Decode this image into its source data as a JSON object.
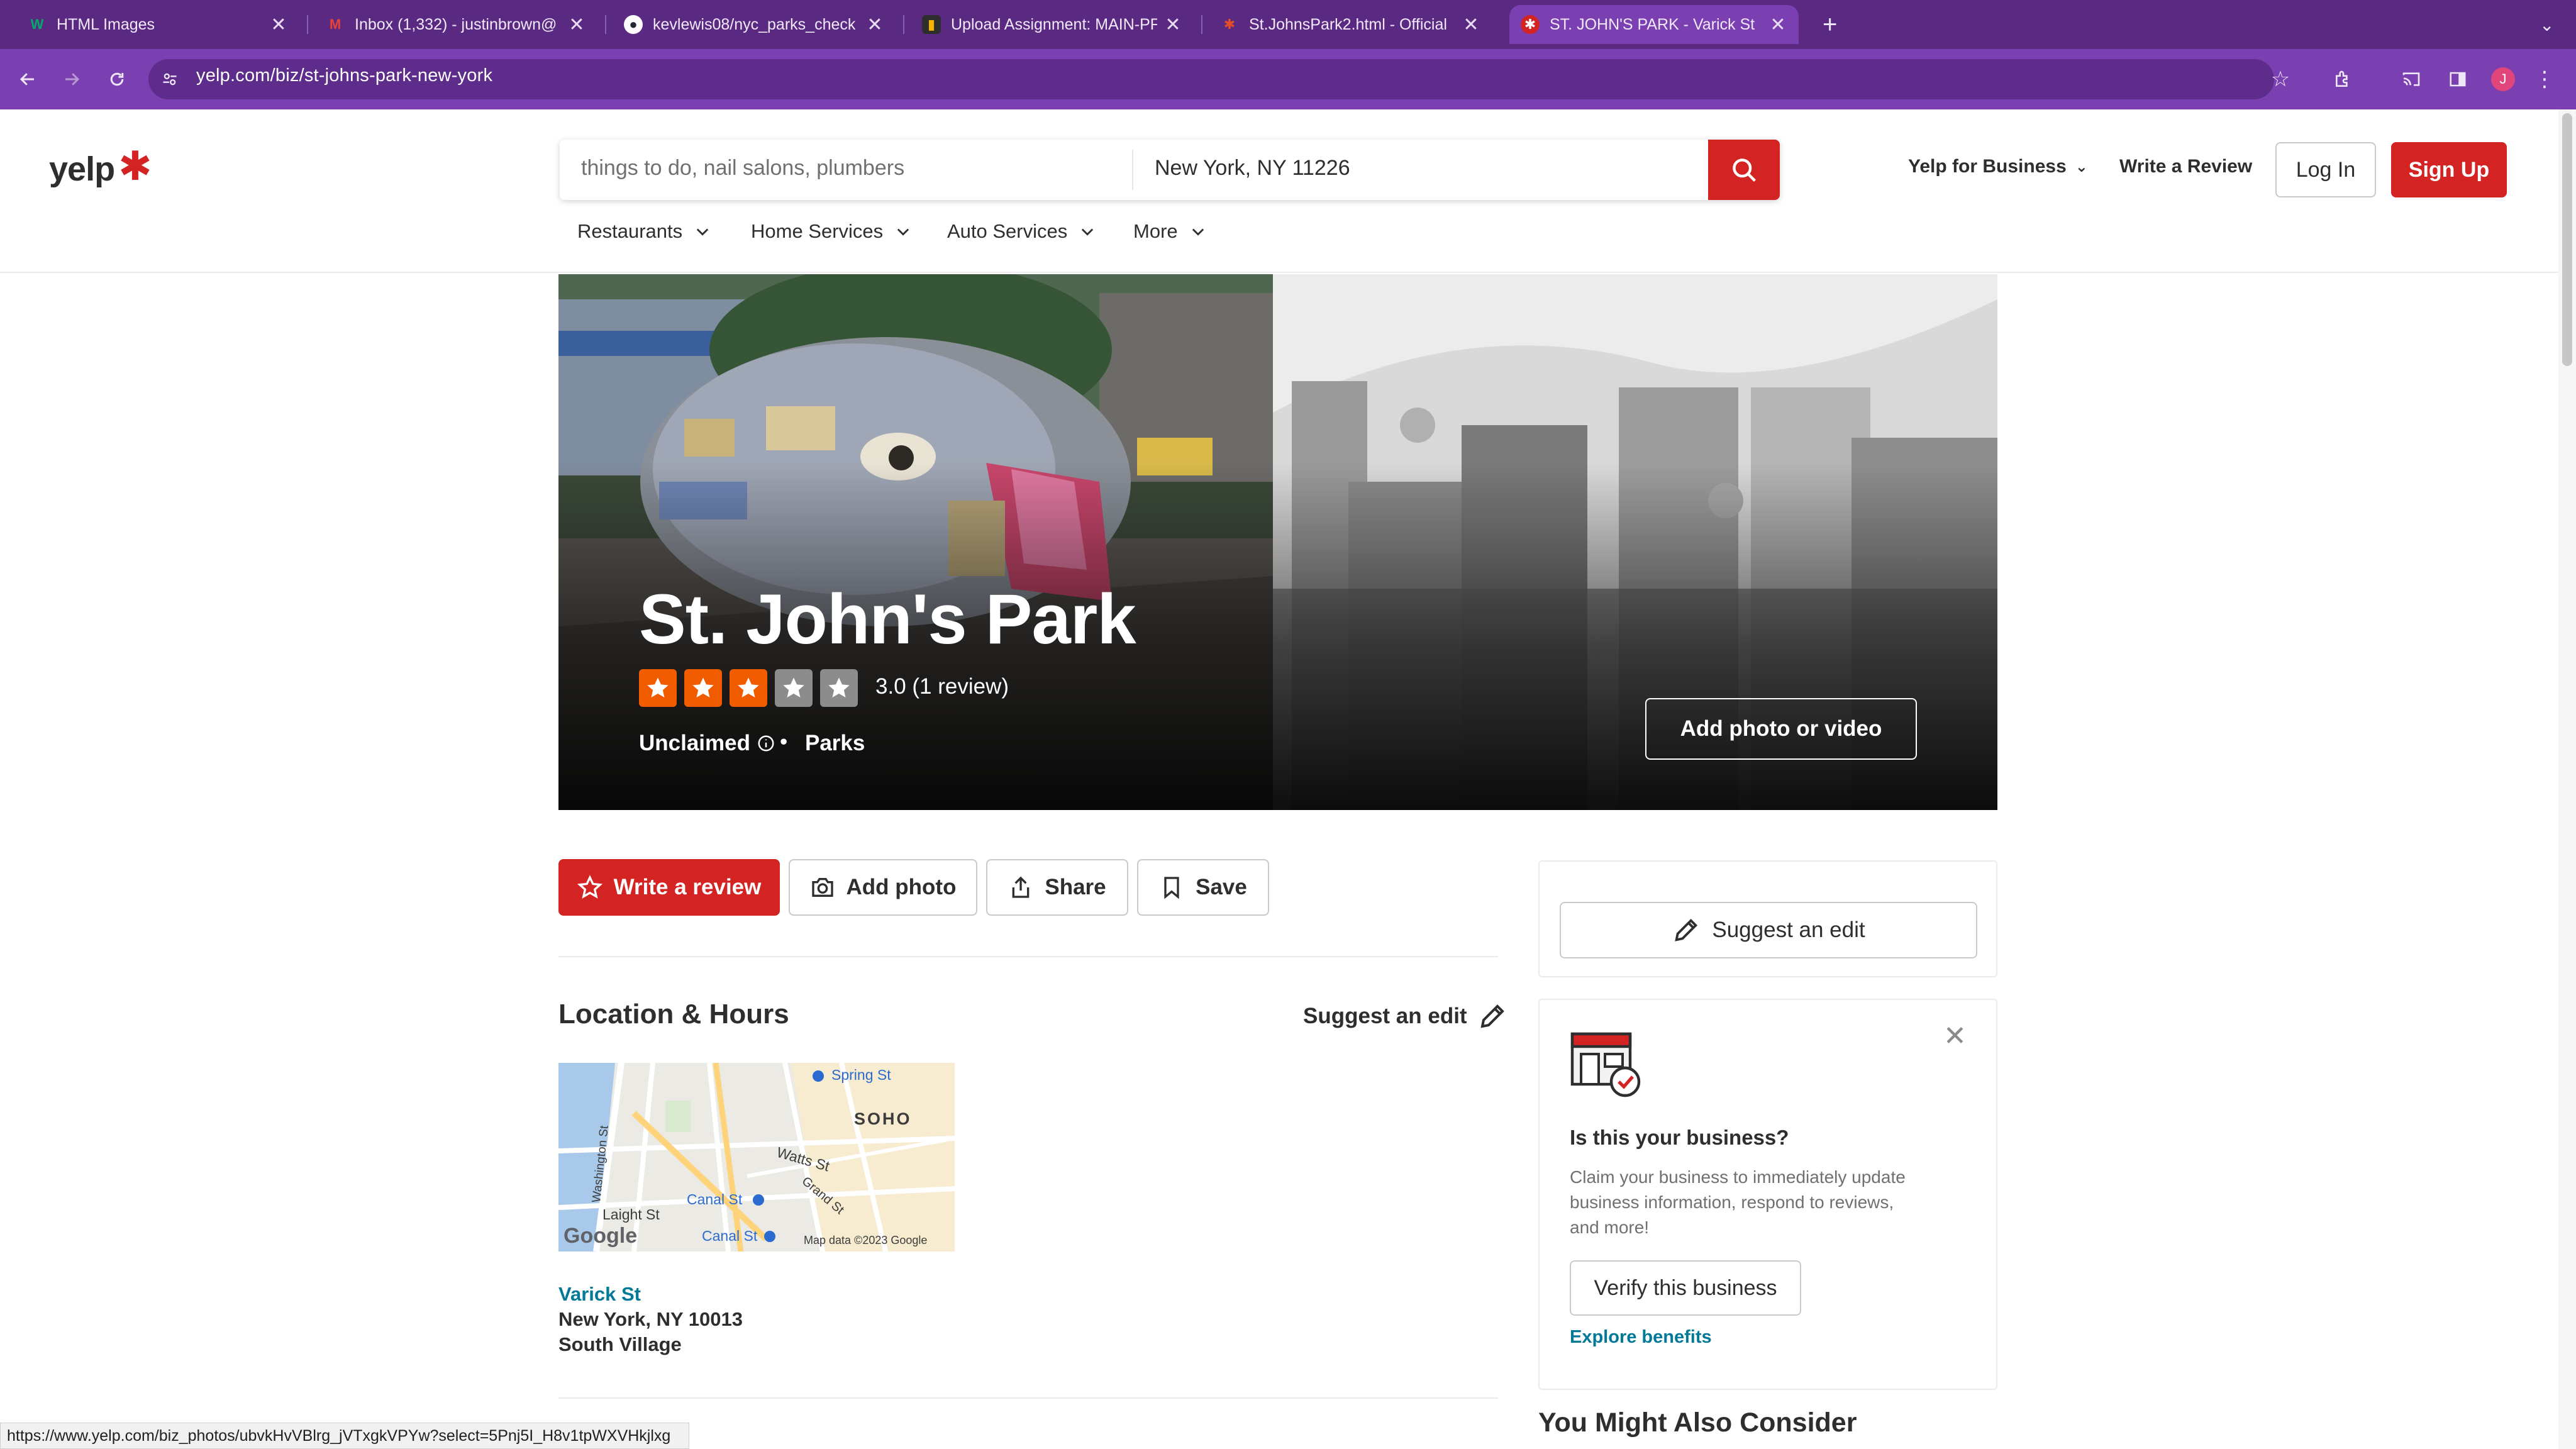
{
  "browser": {
    "tabs": [
      {
        "title": "HTML Images",
        "favicon": "w3schools-icon",
        "color": "#04aa6d"
      },
      {
        "title": "Inbox (1,332) - justinbrown@",
        "favicon": "gmail-icon",
        "color": "#ea4335"
      },
      {
        "title": "kevlewis08/nyc_parks_check",
        "favicon": "github-icon",
        "color": "#ffffff"
      },
      {
        "title": "Upload Assignment: MAIN-PF",
        "favicon": "canvas-icon",
        "color": "#f5b400"
      },
      {
        "title": "St.JohnsPark2.html - Official",
        "favicon": "file-icon",
        "color": "#e44d26"
      },
      {
        "title": "ST. JOHN'S PARK - Varick St",
        "favicon": "yelp-icon",
        "color": "#d32323"
      }
    ],
    "new_tab": "+",
    "close": "✕",
    "url": "yelp.com/biz/st-johns-park-new-york",
    "avatar_letter": "J",
    "status_url": "https://www.yelp.com/biz_photos/ubvkHvVBlrg_jVTxgkVPYw?select=5Pnj5I_H8v1tpWXVHkjlxg"
  },
  "header": {
    "logo": "yelp",
    "search_placeholder": "things to do, nail salons, plumbers",
    "location_value": "New York, NY 11226",
    "yelp_for_business": "Yelp for Business",
    "write_review": "Write a Review",
    "login": "Log In",
    "signup": "Sign Up",
    "categories": [
      "Restaurants",
      "Home Services",
      "Auto Services",
      "More"
    ]
  },
  "business": {
    "name": "St. John's Park",
    "rating": 3.0,
    "stars_filled": 3,
    "stars_total": 5,
    "rating_text": "3.0 (1 review)",
    "claim_status": "Unclaimed",
    "category": "Parks",
    "add_photo_video": "Add photo or video",
    "star_color": "#f15c00"
  },
  "actions": {
    "write_review": "Write a review",
    "add_photo": "Add photo",
    "share": "Share",
    "save": "Save"
  },
  "location": {
    "heading": "Location & Hours",
    "suggest_edit": "Suggest an edit",
    "map_labels": {
      "spring": "Spring St",
      "soho": "SOHO",
      "washington": "Washington St",
      "watts": "Watts St",
      "grand": "Grand St",
      "canal1": "Canal St",
      "canal2": "Canal St",
      "laight": "Laight St",
      "google": "Google",
      "mapdata": "Map data ©2023 Google"
    },
    "street": "Varick St",
    "city": "New York, NY 10013",
    "neighborhood": "South Village"
  },
  "sidebar": {
    "suggest_edit": "Suggest an edit",
    "claim_question": "Is this your business?",
    "claim_desc": "Claim your business to immediately update business information, respond to reviews, and more!",
    "verify": "Verify this business",
    "explore": "Explore benefits",
    "might_consider": "You Might Also Consider"
  }
}
